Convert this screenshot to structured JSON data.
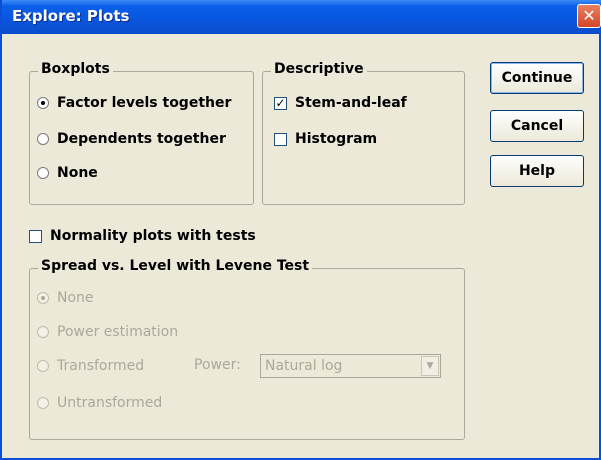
{
  "window": {
    "title": "Explore: Plots",
    "close_glyph": "✕"
  },
  "boxplots": {
    "label": "Boxplots",
    "options": [
      "Factor levels together",
      "Dependents together",
      "None"
    ],
    "selected": "Factor levels together"
  },
  "descriptive": {
    "label": "Descriptive",
    "stem_leaf": "Stem-and-leaf",
    "stem_leaf_checked": true,
    "histogram": "Histogram",
    "histogram_checked": false
  },
  "normality": {
    "label": "Normality plots with tests",
    "checked": false
  },
  "spread": {
    "label": "Spread vs. Level with Levene Test",
    "options": [
      "None",
      "Power estimation",
      "Transformed",
      "Untransformed"
    ],
    "selected": "None",
    "power_label": "Power:",
    "power_value": "Natural log"
  },
  "buttons": {
    "continue": "Continue",
    "cancel": "Cancel",
    "help": "Help"
  },
  "icons": {
    "check_mark": "✓",
    "dropdown_arrow": "▼"
  }
}
